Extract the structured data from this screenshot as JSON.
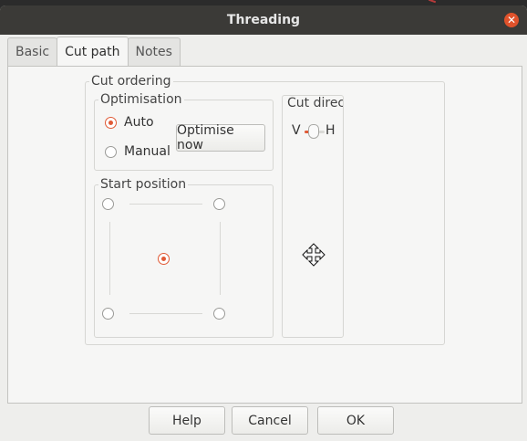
{
  "window": {
    "title": "Threading"
  },
  "tabs": [
    {
      "label": "Basic",
      "active": false
    },
    {
      "label": "Cut path",
      "active": true
    },
    {
      "label": "Notes",
      "active": false
    }
  ],
  "cut_ordering": {
    "label": "Cut ordering",
    "optimisation": {
      "label": "Optimisation",
      "options": [
        {
          "label": "Auto",
          "checked": true
        },
        {
          "label": "Manual",
          "checked": false
        }
      ],
      "optimise_button": "Optimise now"
    },
    "start_position": {
      "label": "Start position",
      "selected": "center"
    },
    "cut_direction": {
      "label": "Cut direct",
      "v_label": "V",
      "h_label": "H"
    }
  },
  "buttons": {
    "help": "Help",
    "cancel": "Cancel",
    "ok": "OK"
  },
  "colors": {
    "accent": "#e05a36",
    "titlebar": "#3b3a37"
  }
}
